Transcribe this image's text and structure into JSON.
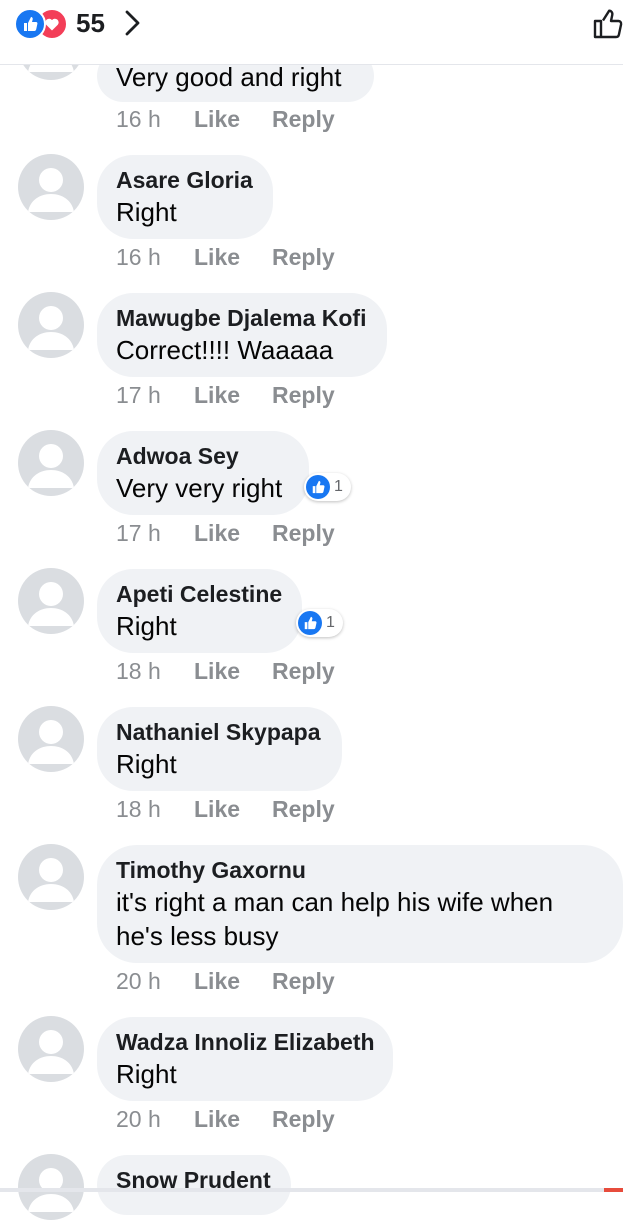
{
  "header": {
    "reaction_count": "55",
    "reaction_icons": [
      "like-icon",
      "love-icon"
    ],
    "like_button_icon": "thumbs-up-outline-icon"
  },
  "actions": {
    "like": "Like",
    "reply": "Reply"
  },
  "colors": {
    "like_blue": "#1877f2",
    "love_red": "#f33e58",
    "bubble_bg": "#f0f2f5",
    "meta_gray": "#8a8d91"
  },
  "comments": [
    {
      "name": "",
      "text": "Very good and right",
      "time": "16 h"
    },
    {
      "name": "Asare Gloria",
      "text": "Right",
      "time": "16 h"
    },
    {
      "name": "Mawugbe Djalema Kofi",
      "text": "Correct!!!! Waaaaa",
      "time": "17 h"
    },
    {
      "name": "Adwoa Sey",
      "text": "Very very right",
      "time": "17 h",
      "reaction_count": "1"
    },
    {
      "name": "Apeti Celestine",
      "text": "Right",
      "time": "18 h",
      "reaction_count": "1"
    },
    {
      "name": "Nathaniel Skypapa",
      "text": "Right",
      "time": "18 h"
    },
    {
      "name": "Timothy Gaxornu",
      "text": "it's right a man can help his wife when he's less busy",
      "time": "20 h"
    },
    {
      "name": "Wadza Innoliz Elizabeth",
      "text": "Right",
      "time": "20 h"
    },
    {
      "name": "Snow Prudent",
      "text": "",
      "time": ""
    }
  ]
}
